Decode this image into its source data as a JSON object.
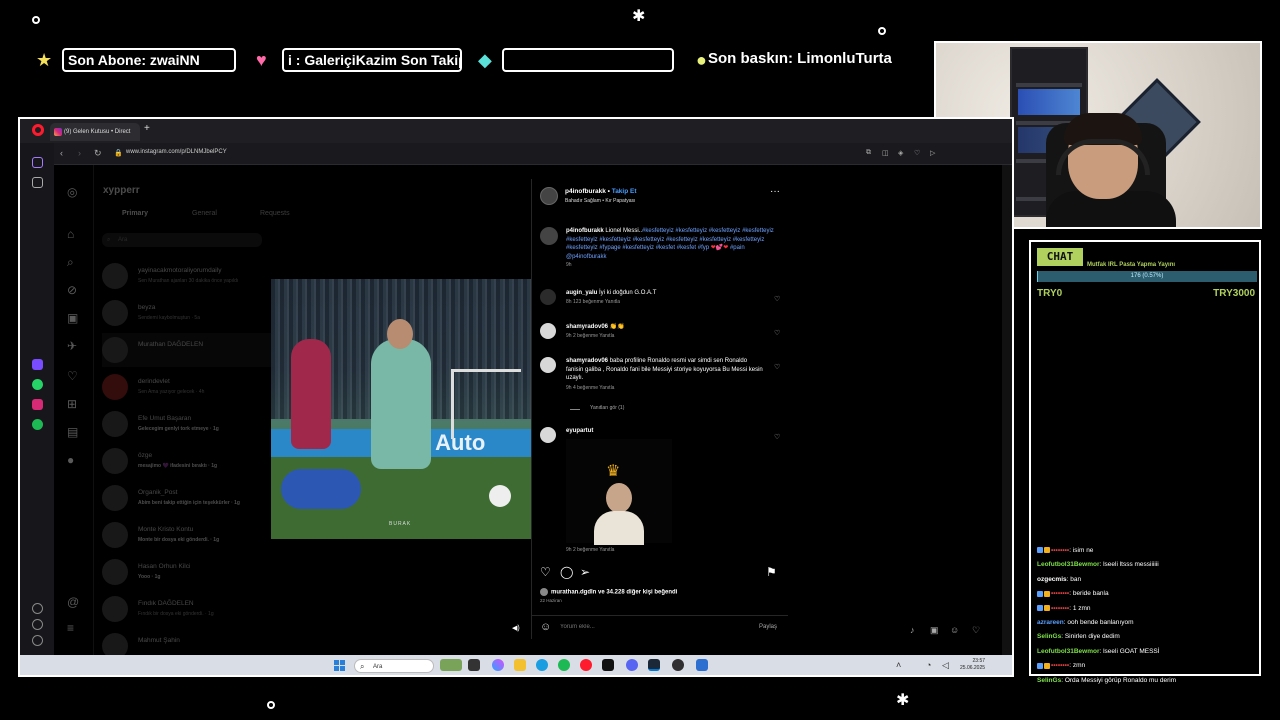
{
  "overlay": {
    "ticker": {
      "last_sub": "Son Abone: zwaiNN",
      "last_follow": "i : GaleriçiKazim    Son Takip",
      "empty_slot": "",
      "last_raid": "Son baskın: LimonluTurta"
    }
  },
  "browser": {
    "tab_title": "(9) Gelen Kutusu • Direct",
    "url": "www.instagram.com/p/DLNMJbelPCY"
  },
  "inbox": {
    "username": "xypperr",
    "tabs": [
      "Primary",
      "General",
      "Requests"
    ],
    "search_placeholder": "Ara",
    "threads": [
      {
        "name": "yayinacakmotoraliyorumdaily",
        "sub": "Sen Murathan ajanları 30 dakika önce yapıldı"
      },
      {
        "name": "beyza",
        "sub": "Sendemi kaybolmuştun · 5a"
      },
      {
        "name": "Murathan DAĞDELEN",
        "sub": ""
      },
      {
        "name": "derindevlet",
        "sub": "Sen Ama yazıyor gelecek · 4h"
      },
      {
        "name": "Efe Umut Başaran",
        "sub": "Gelecegim genlyi tork etmeye · 1g"
      },
      {
        "name": "özge",
        "sub": "mesajimo 💜 ifadesini bıraktı · 1g"
      },
      {
        "name": "Organik_Post",
        "sub": "Abim beni takip ettiğin için teşekkürler · 1g"
      },
      {
        "name": "Monte Kristo Kontu",
        "sub": "Monte bir dosya eki gönderdi. · 1g"
      },
      {
        "name": "Hasan Orhun Kilci",
        "sub": "Yooo · 1g"
      },
      {
        "name": "Fındık DAĞDELEN",
        "sub": "Fındık bir dosya eki gönderdi. · 1g"
      },
      {
        "name": "Mahmut Şahin",
        "sub": ""
      }
    ]
  },
  "post": {
    "author": "p4inofburakk",
    "follow_label": "Takip Et",
    "song": "Bahadır Sağlam • Kır Papatyası",
    "caption_user": "p4inofburakk",
    "caption_text": "Lionel Messi..",
    "caption_tags": "#kesfetteyiz #kesfetteyiz #kesfetteyiz #kesfetteyiz #kesfetteyiz #kesfetteyiz #kesfetteyiz #kesfetteyiz #kesfetteyiz #kesfetteyiz #kesfetteyiz #fypage #kesfetteyiz #kesfet #kesfet #fyp",
    "caption_tail": "#pain @p4inofburakk",
    "caption_time": "9h",
    "video_watermark": "BURAK",
    "ad_text": "Audi Auto",
    "comments": [
      {
        "user": "augin_yalu",
        "text": "İyi ki doğdun G.O.A.T",
        "meta": "8h  123 beğenme  Yanıtla"
      },
      {
        "user": "shamyradov06",
        "text": "👏👏",
        "meta": "9h  2 beğenme  Yanıtla"
      },
      {
        "user": "shamyradov06",
        "text": "baba profiline Ronaldo resmi var simdi sen Ronaldo fanisin galiba , Ronaldo fani bile Messiyi storiye koyuyorsa Bu Messi kesin uzaylı.",
        "meta": "9h  4 beğenme  Yanıtla"
      },
      {
        "user": "eyupartut",
        "text": "",
        "meta": "9h  2 beğenme  Yanıtla"
      }
    ],
    "replies_label": "Yanıtları gör (1)",
    "likes_text": "murathan.dgdln ve 34.228 diğer kişi beğendi",
    "date": "22 Haziran",
    "comment_placeholder": "Yorum ekle...",
    "post_button": "Paylaş"
  },
  "taskbar": {
    "search_label": "Ara",
    "time": "23:57",
    "date": "25.06.2025"
  },
  "chat": {
    "title": "CHAT",
    "goal_title": "Mutfak IRL Pasta Yapma Yayını",
    "goal_value": "176 (0.57%)",
    "goal_fraction": 0.0057,
    "goal_min": "TRY0",
    "goal_max": "TRY3000",
    "messages": [
      {
        "user": "••••••••",
        "text": ": isim ne",
        "color": "#e04040",
        "badges": true
      },
      {
        "user": "Leofutbol31Bewmor",
        "text": ": lseeli ltsss messiiiiii",
        "color": "#7ee04a",
        "badges": false
      },
      {
        "user": "ozgecmis",
        "text": ": ban",
        "color": "#ffffff",
        "badges": false
      },
      {
        "user": "••••••••",
        "text": ": beride banla",
        "color": "#e04040",
        "badges": true
      },
      {
        "user": "••••••••",
        "text": ": 1 zmn",
        "color": "#e04040",
        "badges": true
      },
      {
        "user": "azrareen",
        "text": ": ooh bende banlanıyom",
        "color": "#5aa0ff",
        "badges": false
      },
      {
        "user": "SelinGs",
        "text": ": Sinirlen diye dedim",
        "color": "#7ee04a",
        "badges": false
      },
      {
        "user": "Leofutbol31Bewmor",
        "text": ": lseeli GOAT MESSİ",
        "color": "#7ee04a",
        "badges": false
      },
      {
        "user": "••••••••",
        "text": ": zmn",
        "color": "#e04040",
        "badges": true
      },
      {
        "user": "SelinGs",
        "text": ": Orda Messiyi görüp Ronaldo mu derim",
        "color": "#7ee04a",
        "badges": false
      }
    ]
  },
  "colors": {
    "accent_green": "#b0d15e",
    "goal_bar": "#5ad4f0",
    "ig_link": "#4a9eff",
    "opera_red": "#ff1b2d"
  }
}
